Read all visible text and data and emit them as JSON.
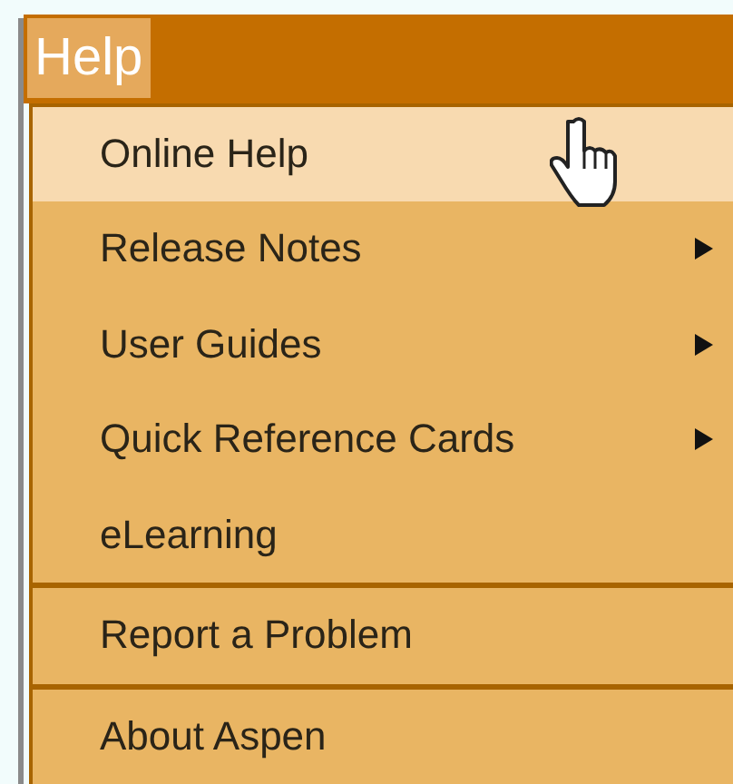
{
  "menubar": {
    "menus": [
      {
        "label": "Help",
        "selected": true
      }
    ]
  },
  "menu": {
    "sections": [
      {
        "items": [
          {
            "label": "Online Help",
            "selected": true,
            "submenu": false
          },
          {
            "label": "Release Notes",
            "selected": false,
            "submenu": true
          },
          {
            "label": "User Guides",
            "selected": false,
            "submenu": true
          },
          {
            "label": "Quick Reference Cards",
            "selected": false,
            "submenu": true
          },
          {
            "label": "eLearning",
            "selected": false,
            "submenu": false
          }
        ]
      },
      {
        "items": [
          {
            "label": "Report a Problem",
            "selected": false,
            "submenu": false
          }
        ]
      },
      {
        "items": [
          {
            "label": "About Aspen",
            "selected": false,
            "submenu": false
          }
        ]
      }
    ]
  }
}
